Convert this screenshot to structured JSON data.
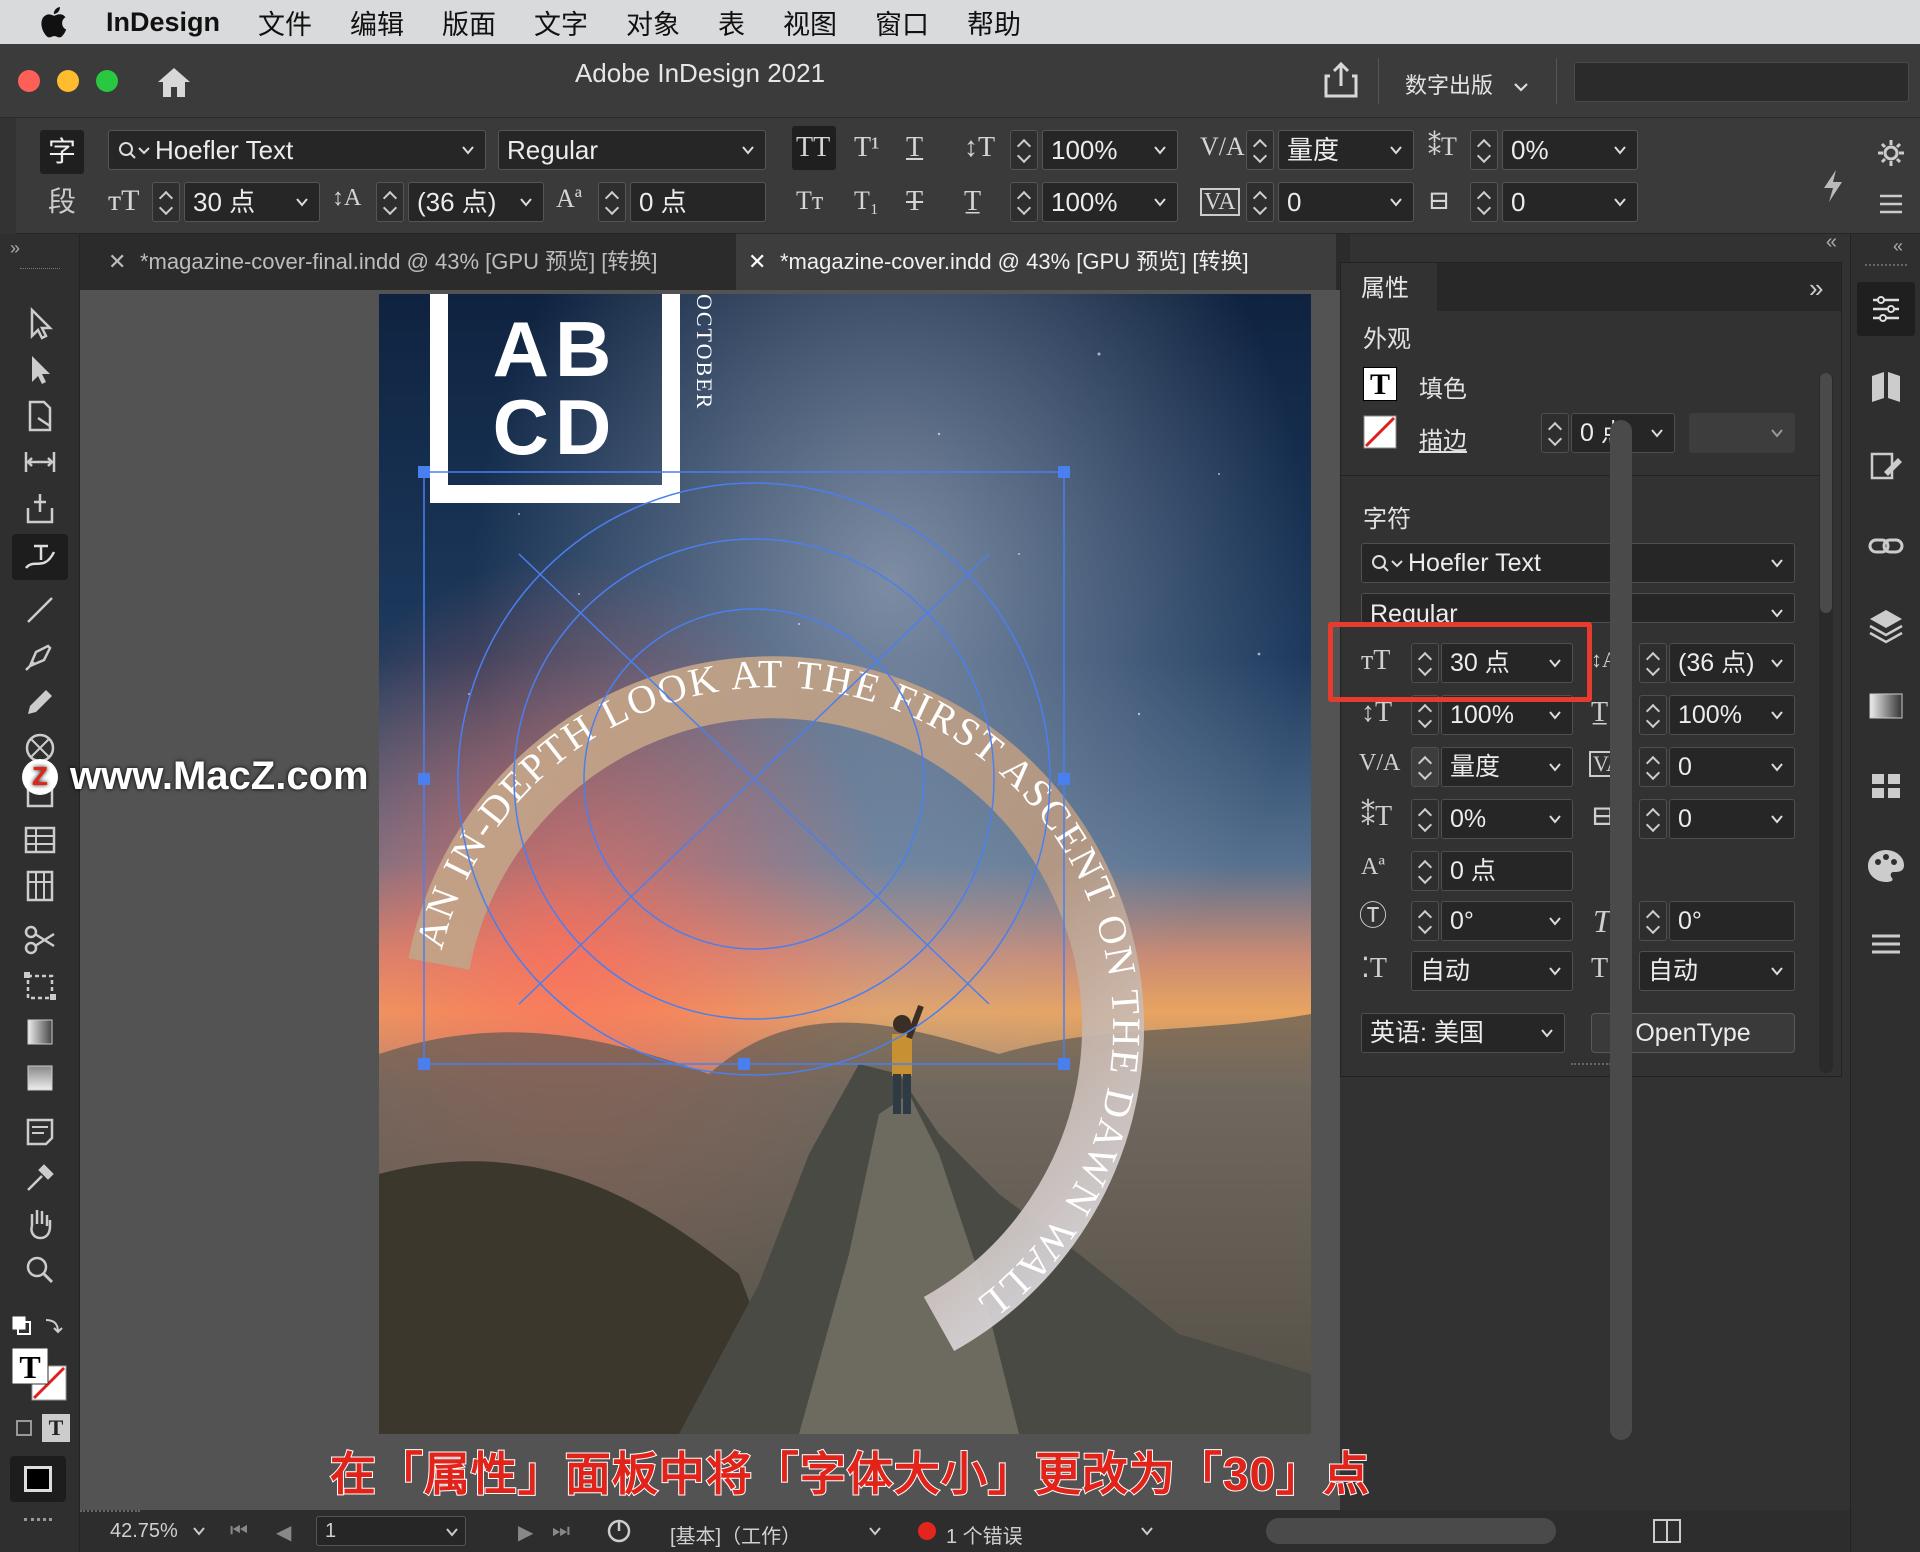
{
  "menubar": {
    "app": "InDesign",
    "items": [
      "文件",
      "编辑",
      "版面",
      "文字",
      "对象",
      "表",
      "视图",
      "窗口",
      "帮助"
    ]
  },
  "titlebar": {
    "title": "Adobe InDesign 2021",
    "workspace": "数字出版"
  },
  "control": {
    "char_mode": "字",
    "para_mode": "段",
    "font_family": "Hoefler Text",
    "font_style": "Regular",
    "font_size": "30 点",
    "leading": "(36 点)",
    "baseline_shift": "0 点",
    "vertical_scale": "100%",
    "horizontal_scale": "100%",
    "kerning": "量度",
    "tracking": "0",
    "skew": "0%",
    "char_spacing": "0"
  },
  "tabs": [
    {
      "label": "*magazine-cover-final.indd @ 43% [GPU 预览] [转换]",
      "active": false
    },
    {
      "label": "*magazine-cover.indd @ 43% [GPU 预览] [转换]",
      "active": true
    }
  ],
  "cover": {
    "logo_line1": "AB",
    "logo_line2": "CD",
    "month": "OCTOBER",
    "arc_text": "AN IN-DEPTH LOOK AT THE FIRST ASCENT ON THE DAWN WALL"
  },
  "properties": {
    "tab": "属性",
    "appearance_header": "外观",
    "fill_label": "填色",
    "stroke_label": "描边",
    "stroke_weight": "0 点",
    "character_header": "字符",
    "font_family": "Hoefler Text",
    "font_style": "Regular",
    "font_size": "30 点",
    "leading": "(36 点)",
    "vertical_scale": "100%",
    "horizontal_scale": "100%",
    "kerning": "量度",
    "tracking": "0",
    "skew": "0%",
    "char_spacing": "0",
    "baseline_shift": "0 点",
    "rotation": "0°",
    "italic_angle": "0°",
    "auto1": "自动",
    "auto2": "自动",
    "language": "英语: 美国",
    "opentype": "OpenType"
  },
  "status": {
    "zoom": "42.75%",
    "page": "1",
    "style": "[基本]（工作）",
    "errors": "1 个错误"
  },
  "overlay": {
    "watermark": "www.MacZ.com",
    "watermark_logo": "Z",
    "caption": "在「属性」面板中将「字体大小」更改为「30」点"
  },
  "colors": {
    "highlight": "#e83b2f",
    "caption": "#e2231a",
    "selection": "#4a7ff0"
  }
}
